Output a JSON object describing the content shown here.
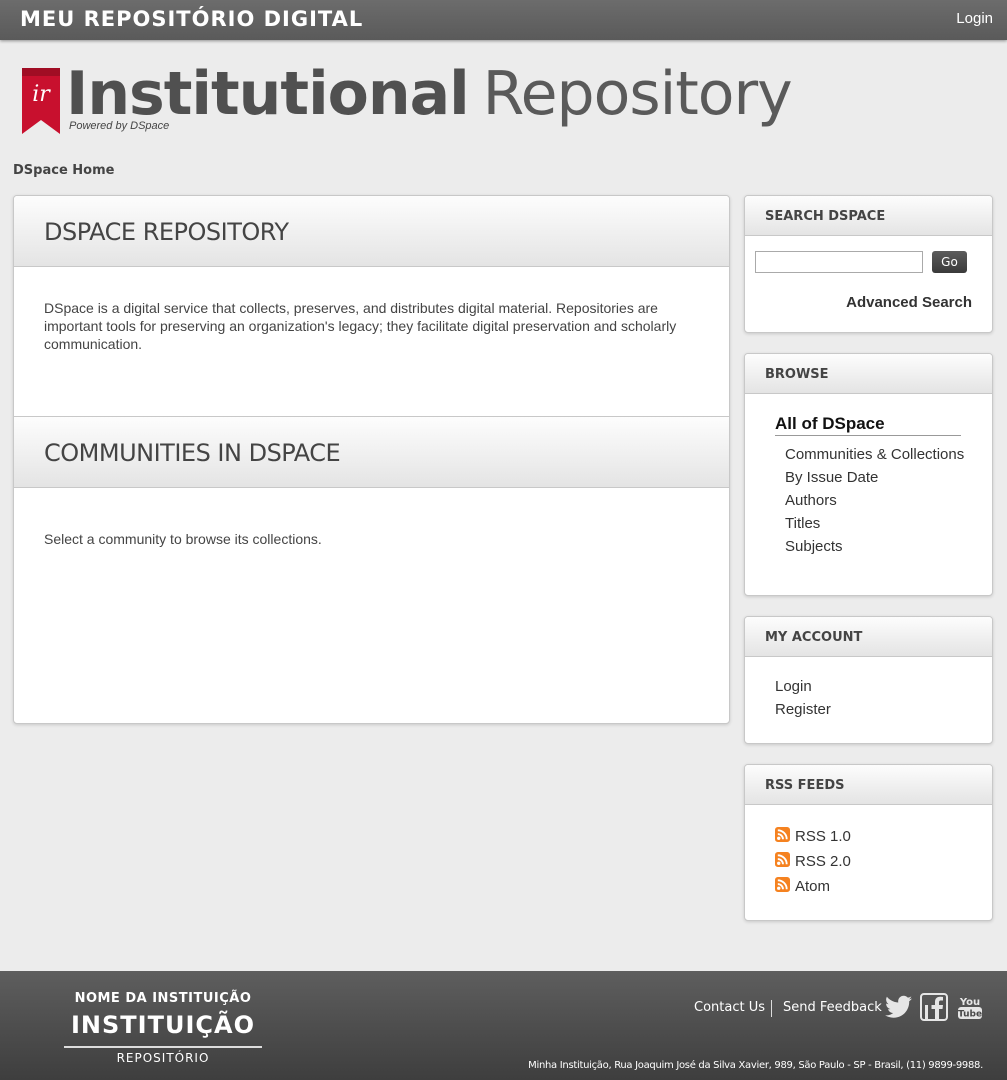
{
  "topbar": {
    "site_name": "MEU REPOSITÓRIO DIGITAL",
    "login_label": "Login"
  },
  "logo": {
    "badge_text": "ir",
    "title_bold": "Institutional",
    "title_light": "Repository",
    "powered": "Powered by DSpace"
  },
  "breadcrumb": {
    "home": "DSpace Home"
  },
  "main": {
    "repo_title": "DSPACE REPOSITORY",
    "repo_text": "DSpace is a digital service that collects, preserves, and distributes digital material. Repositories are important tools for preserving an organization's legacy; they facilitate digital preservation and scholarly communication.",
    "communities_title": "COMMUNITIES IN DSPACE",
    "communities_text": "Select a community to browse its collections."
  },
  "sidebar": {
    "search": {
      "title": "SEARCH DSPACE",
      "input_value": "",
      "go_label": "Go",
      "advanced_label": "Advanced Search"
    },
    "browse": {
      "title": "BROWSE",
      "heading": "All of DSpace",
      "items": [
        "Communities & Collections",
        "By Issue Date",
        "Authors",
        "Titles",
        "Subjects"
      ]
    },
    "account": {
      "title": "MY ACCOUNT",
      "items": [
        "Login",
        "Register"
      ]
    },
    "rss": {
      "title": "RSS FEEDS",
      "items": [
        "RSS 1.0",
        "RSS 2.0",
        "Atom"
      ],
      "icon": "rss-icon",
      "icon_color": "#f58220"
    }
  },
  "footer": {
    "inst_small": "NOME DA INSTITUIÇÃO",
    "inst_big": "INSTITUIÇÃO",
    "inst_repo": "REPOSITÓRIO",
    "contact": "Contact Us",
    "feedback": "Send Feedback",
    "social_icons": [
      "twitter-icon",
      "facebook-icon",
      "youtube-icon"
    ],
    "address": "Minha Instituição, Rua Joaquim José da Silva Xavier, 989, São Paulo - SP - Brasil, (11) 9899-9988."
  },
  "colors": {
    "accent_red": "#c8102e",
    "topbar": "#626262",
    "footer": "#4a4a4a"
  }
}
